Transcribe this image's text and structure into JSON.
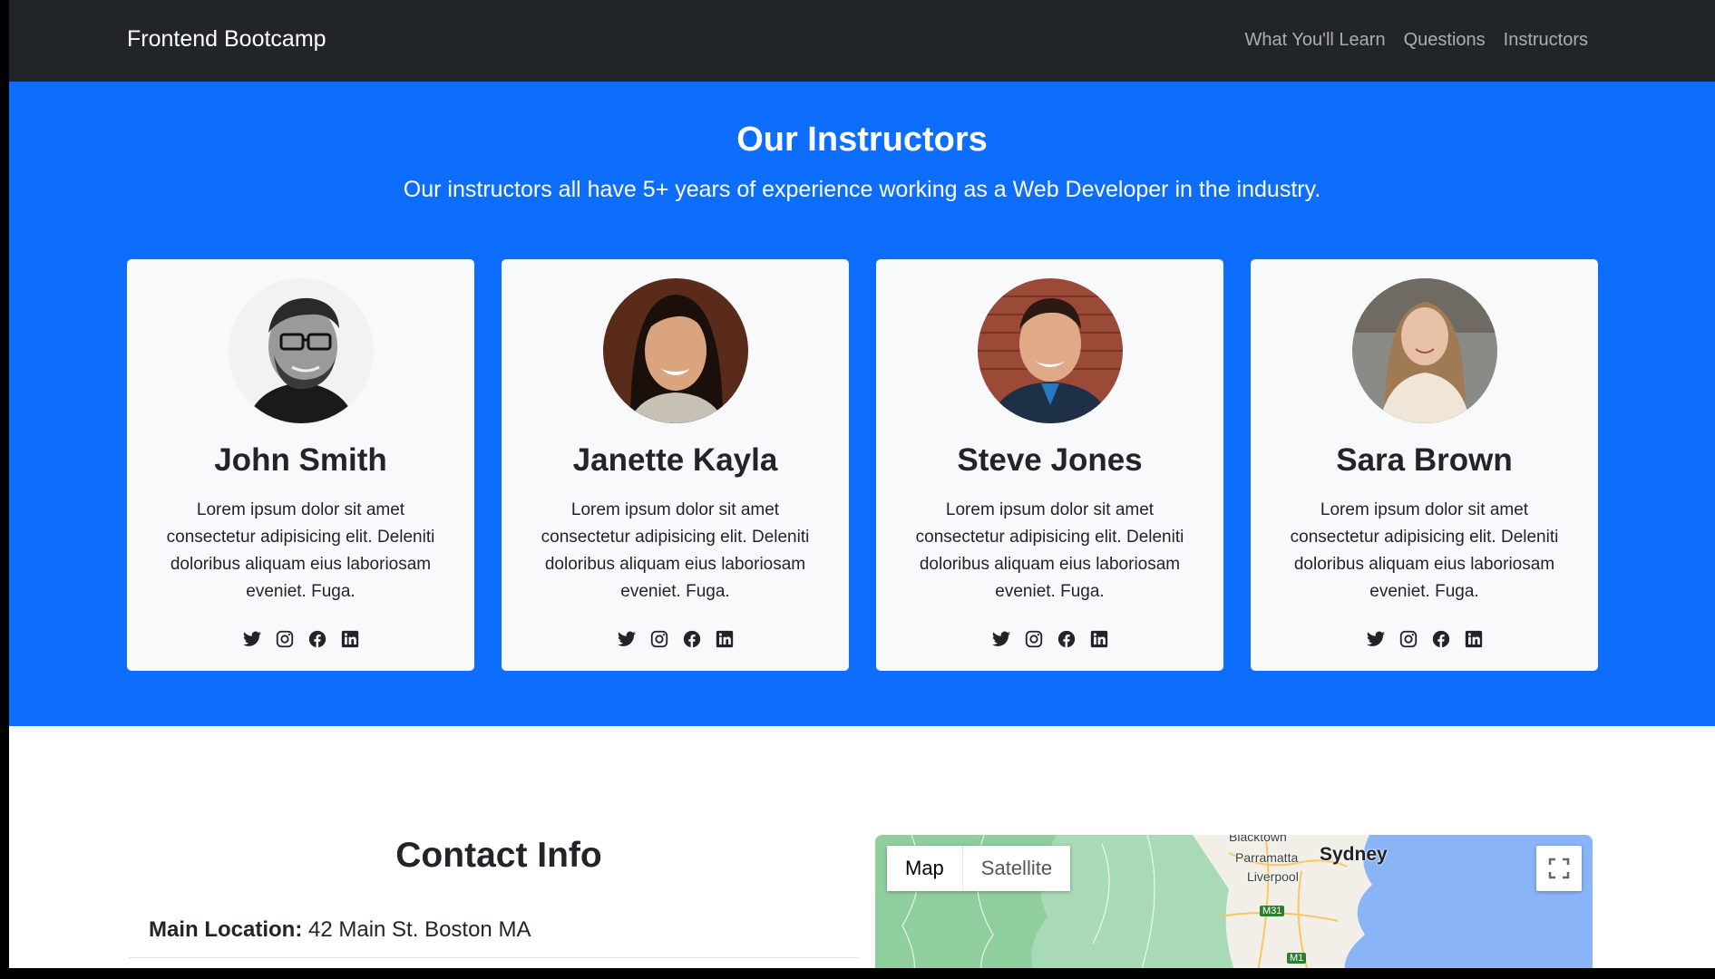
{
  "navbar": {
    "brand": "Frontend Bootcamp",
    "links": [
      "What You'll Learn",
      "Questions",
      "Instructors"
    ]
  },
  "instructors": {
    "title": "Our Instructors",
    "lead": "Our instructors all have 5+ years of experience working as a Web Developer in the industry.",
    "cards": [
      {
        "name": "John Smith",
        "text": "Lorem ipsum dolor sit amet consectetur adipisicing elit. Deleniti doloribus aliquam eius laboriosam eveniet. Fuga."
      },
      {
        "name": "Janette Kayla",
        "text": "Lorem ipsum dolor sit amet consectetur adipisicing elit. Deleniti doloribus aliquam eius laboriosam eveniet. Fuga."
      },
      {
        "name": "Steve Jones",
        "text": "Lorem ipsum dolor sit amet consectetur adipisicing elit. Deleniti doloribus aliquam eius laboriosam eveniet. Fuga."
      },
      {
        "name": "Sara Brown",
        "text": "Lorem ipsum dolor sit amet consectetur adipisicing elit. Deleniti doloribus aliquam eius laboriosam eveniet. Fuga."
      }
    ],
    "social_icons": [
      "twitter-icon",
      "instagram-icon",
      "facebook-icon",
      "linkedin-icon"
    ]
  },
  "contact": {
    "title": "Contact Info",
    "location_label": "Main Location:",
    "location_value": "42 Main St. Boston MA"
  },
  "map": {
    "type_options": [
      "Map",
      "Satellite"
    ],
    "selected_type": "Map",
    "labels": {
      "city": "Sydney",
      "parramatta": "Parramatta",
      "liverpool": "Liverpool",
      "blacktown": "Blacktown",
      "m31": "M31",
      "m1": "M1"
    }
  },
  "colors": {
    "navbar": "#212529",
    "section_bg": "#0d6efd",
    "card_bg": "#f8f9fa",
    "water": "#8ab4f8",
    "land": "#a8dab5"
  }
}
